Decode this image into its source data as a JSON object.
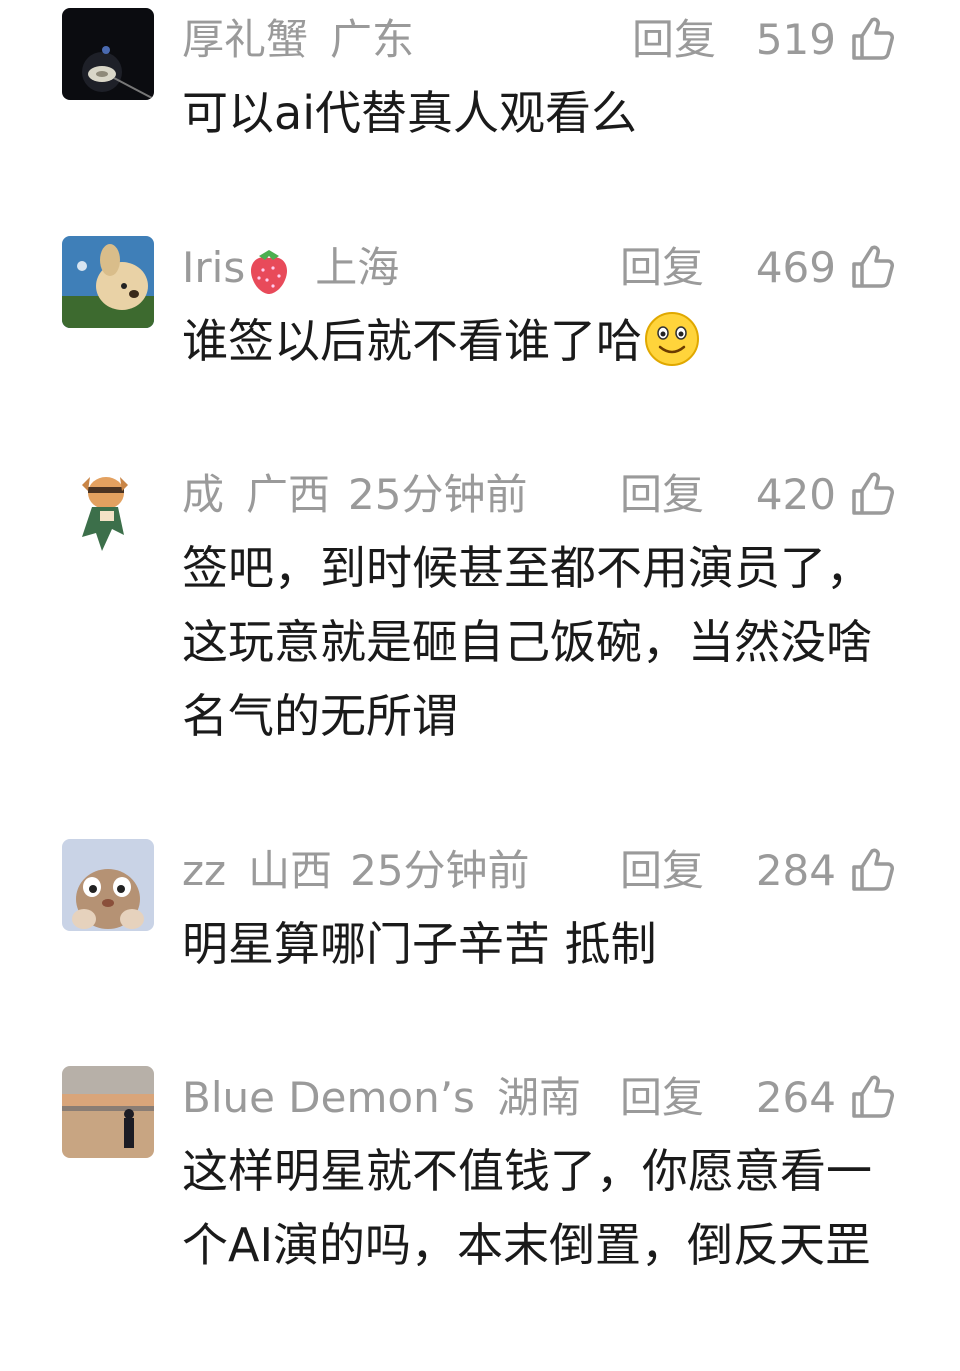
{
  "comments": [
    {
      "username": "厚礼蟹",
      "location": "广东",
      "time": "",
      "reply_label": "回复",
      "likes": "519",
      "text": "可以ai代替真人观看么",
      "avatar_icon": "night-light-avatar"
    },
    {
      "username": "Iris",
      "location": "上海",
      "time": "",
      "reply_label": "回复",
      "likes": "469",
      "text": "谁签以后就不看谁了哈",
      "avatar_icon": "dog-plush-avatar",
      "username_emoji": "strawberry-icon",
      "text_emoji": "smiley-icon"
    },
    {
      "username": "成",
      "location": "广西",
      "time": "25分钟前",
      "reply_label": "回复",
      "likes": "420",
      "text": "签吧，到时候甚至都不用演员了，这玩意就是砸自己饭碗，当然没啥名气的无所谓",
      "avatar_icon": "cartoon-cat-avatar"
    },
    {
      "username": "zz",
      "location": "山西",
      "time": "25分钟前",
      "reply_label": "回复",
      "likes": "284",
      "text": "明星算哪门子辛苦 抵制",
      "avatar_icon": "bunny-avatar"
    },
    {
      "username": "Blue Demon’s",
      "location": "湖南",
      "time": "",
      "reply_label": "回复",
      "likes": "264",
      "text": "这样明星就不值钱了，你愿意看一个AI演的吗，本末倒置，倒反天罡",
      "avatar_icon": "beach-sunset-avatar"
    }
  ],
  "colors": {
    "meta_gray": "#9a9a9a",
    "text_dark": "#1a1a1a"
  }
}
